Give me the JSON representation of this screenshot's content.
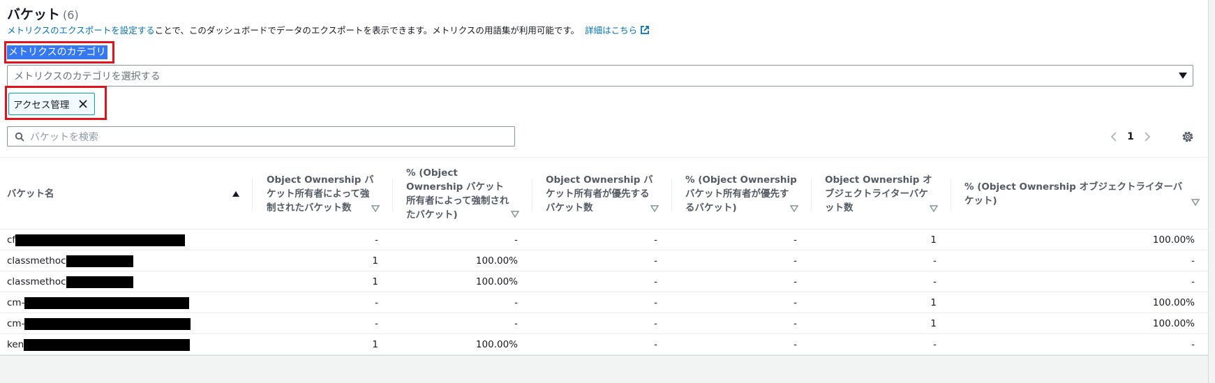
{
  "section": {
    "title": "バケット",
    "count": "(6)"
  },
  "description": {
    "link1": "メトリクスのエクスポートを設定する",
    "text": "ことで、このダッシュボードでデータのエクスポートを表示できます。メトリクスの用語集が利用可能です。",
    "link2": "詳細はこちら"
  },
  "category": {
    "label": "メトリクスのカテゴリ",
    "select_placeholder": "メトリクスのカテゴリを選択する",
    "token": "アクセス管理"
  },
  "search": {
    "placeholder": "バケットを検索"
  },
  "pagination": {
    "page": "1"
  },
  "table": {
    "headers": [
      "バケット名",
      "Object Ownership バケット所有者によって強制されたバケット数",
      "% (Object Ownership バケット所有者によって強制されたバケット)",
      "Object Ownership バケット所有者が優先するバケット数",
      "% (Object Ownership バケット所有者が優先するバケット)",
      "Object Ownership オブジェクトライターバケット数",
      "% (Object Ownership オブジェクトライターバケット)"
    ],
    "rows": [
      {
        "name_prefix": "cf",
        "c1": "-",
        "c2": "-",
        "c3": "-",
        "c4": "-",
        "c5": "1",
        "c6": "100.00%"
      },
      {
        "name_prefix": "classmethoc",
        "c1": "1",
        "c2": "100.00%",
        "c3": "-",
        "c4": "-",
        "c5": "-",
        "c6": "-"
      },
      {
        "name_prefix": "classmethoc",
        "c1": "1",
        "c2": "100.00%",
        "c3": "-",
        "c4": "-",
        "c5": "-",
        "c6": "-"
      },
      {
        "name_prefix": "cm-",
        "c1": "-",
        "c2": "-",
        "c3": "-",
        "c4": "-",
        "c5": "1",
        "c6": "100.00%"
      },
      {
        "name_prefix": "cm-",
        "c1": "-",
        "c2": "-",
        "c3": "-",
        "c4": "-",
        "c5": "1",
        "c6": "100.00%"
      },
      {
        "name_prefix": "ken",
        "c1": "1",
        "c2": "100.00%",
        "c3": "-",
        "c4": "-",
        "c5": "-",
        "c6": "-"
      }
    ]
  },
  "colors": {
    "link": "#0073bb",
    "highlight": "#e0141e",
    "selection": "#3478f6",
    "token_border": "#00a1c9"
  }
}
